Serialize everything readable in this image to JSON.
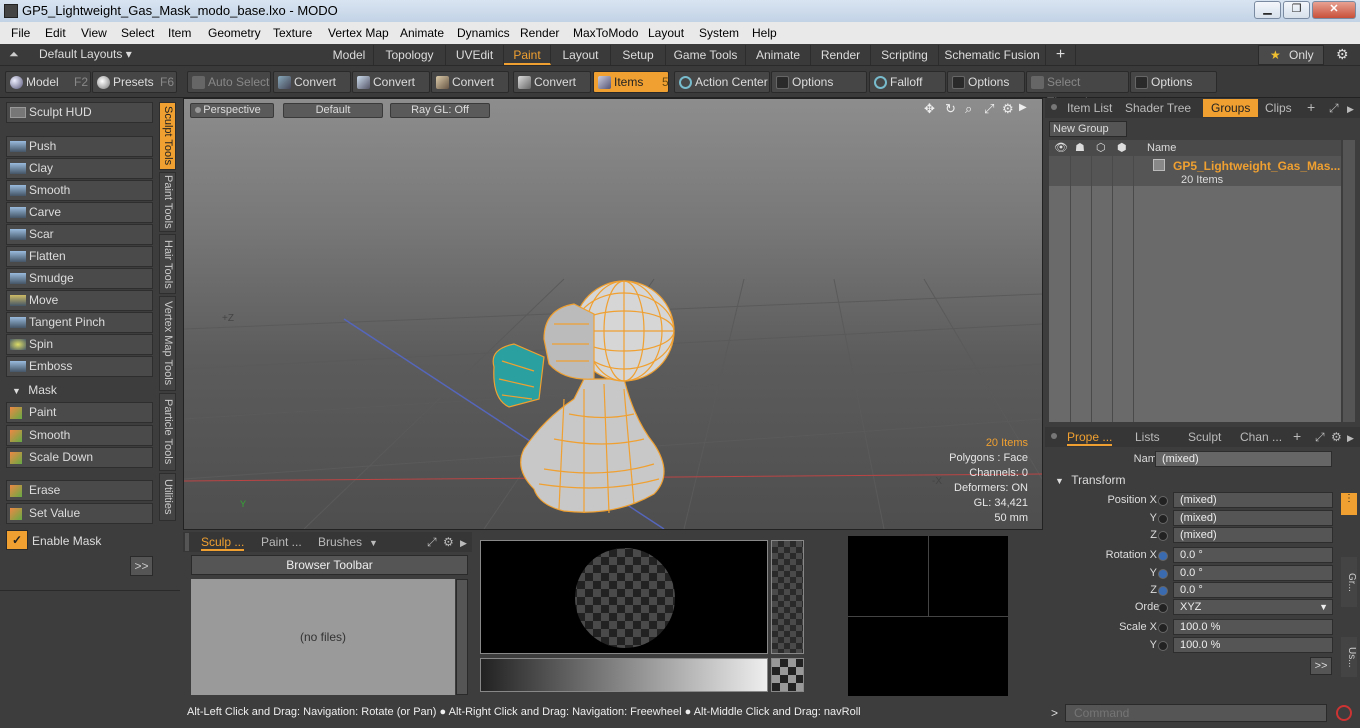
{
  "window": {
    "title": "GP5_Lightweight_Gas_Mask_modo_base.lxo - MODO"
  },
  "menu": [
    "File",
    "Edit",
    "View",
    "Select",
    "Item",
    "Geometry",
    "Texture",
    "Vertex Map",
    "Animate",
    "Dynamics",
    "Render",
    "MaxToModo",
    "Layout",
    "System",
    "Help"
  ],
  "layout_bar": {
    "default_layouts": "Default Layouts ▾",
    "tabs": [
      "Model",
      "Topology",
      "UVEdit",
      "Paint",
      "Layout",
      "Setup",
      "Game Tools",
      "Animate",
      "Render",
      "Scripting",
      "Schematic Fusion",
      "+"
    ],
    "active_tab": "Paint",
    "only_label": "Only"
  },
  "toolbar": {
    "model": "Model",
    "model_key": "F2",
    "presets": "Presets",
    "presets_key": "F6",
    "auto_select": "Auto Select",
    "convert": "Convert",
    "items": "Items",
    "items_key": "5",
    "action_center": "Action Center",
    "options": "Options",
    "falloff": "Falloff",
    "select_through": "Select Through"
  },
  "left_panel": {
    "sculpt_hud": "Sculpt HUD",
    "tools": [
      "Push",
      "Clay",
      "Smooth",
      "Carve",
      "Scar",
      "Flatten",
      "Smudge",
      "Move",
      "Tangent Pinch",
      "Spin",
      "Emboss"
    ],
    "mask_header": "Mask",
    "mask_tools": [
      "Paint",
      "Smooth",
      "Scale Down"
    ],
    "erase": "Erase",
    "set_value": "Set Value",
    "enable_mask": "Enable Mask",
    "expand": ">>",
    "vtabs": [
      "Sculpt Tools",
      "Paint Tools",
      "Hair Tools",
      "Vertex Map Tools",
      "Particle Tools",
      "Utilities"
    ]
  },
  "viewport": {
    "perspective": "Perspective",
    "default": "Default",
    "raygl": "Ray GL: Off",
    "axis_z": "+Z",
    "axis_x": "-X",
    "axis_y": "Y",
    "info": [
      "20 Items",
      "Polygons : Face",
      "Channels: 0",
      "Deformers: ON",
      "GL: 34,421",
      "50 mm"
    ]
  },
  "bottom_panel": {
    "tabs": [
      "Sculp ...",
      "Paint ...",
      "Brushes"
    ],
    "browser_toolbar": "Browser Toolbar",
    "no_files": "(no files)"
  },
  "right_top": {
    "tabs": [
      "Item List",
      "Shader Tree",
      "Groups",
      "Clips",
      "+"
    ],
    "active": "Groups",
    "new_group": "New Group",
    "name_header": "Name",
    "group_name": "GP5_Lightweight_Gas_Mas...",
    "group_items": "20 Items"
  },
  "properties": {
    "tabs": [
      "Prope ...",
      "Lists",
      "Sculpt",
      "Chan ...",
      "+"
    ],
    "name_label": "Name",
    "name_value": "(mixed)",
    "transform": "Transform",
    "position_x": "Position X",
    "y": "Y",
    "z": "Z",
    "pos_values": [
      "(mixed)",
      "(mixed)",
      "(mixed)"
    ],
    "rotation_x": "Rotation X",
    "rot_values": [
      "0.0 °",
      "0.0 °",
      "0.0 °"
    ],
    "order_label": "Order",
    "order_value": "XYZ",
    "scale_x": "Scale X",
    "scale_values": [
      "100.0 %",
      "100.0 %"
    ],
    "expand": ">>",
    "side_tabs": [
      "Gr...",
      "Us..."
    ]
  },
  "status": {
    "text1": "Alt-Left Click and Drag: Navigation: Rotate (or Pan)",
    "text2": "Alt-Right Click and Drag: Navigation: Freewheel",
    "text3": "Alt-Middle Click and Drag: navRoll"
  },
  "command": {
    "placeholder": "Command",
    "arrow": ">"
  }
}
